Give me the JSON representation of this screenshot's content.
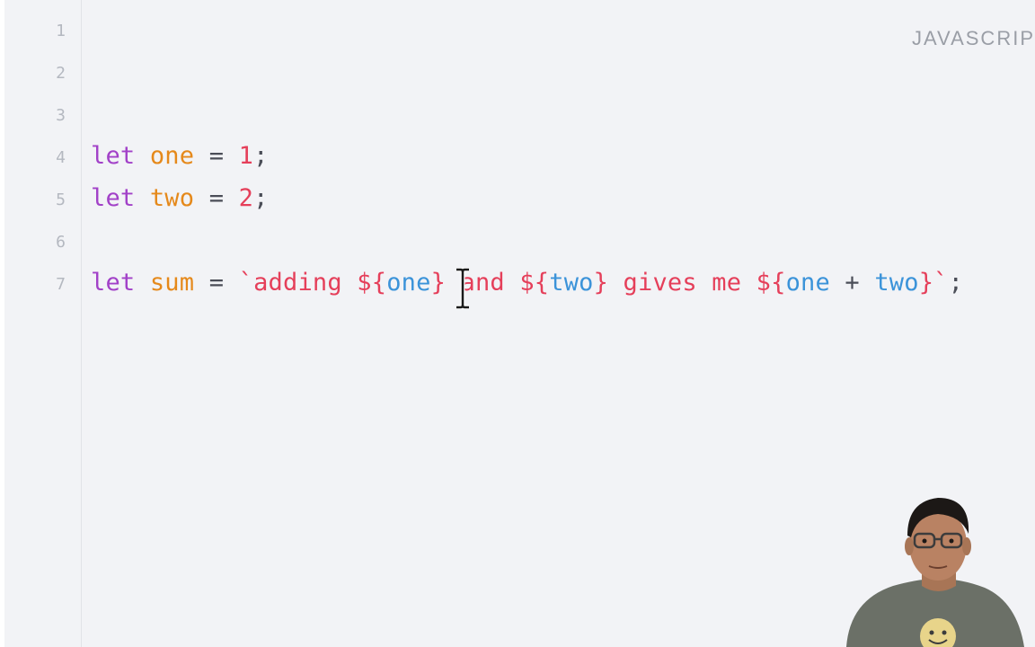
{
  "editor": {
    "language_label": "JAVASCRIP",
    "line_numbers": [
      "1",
      "2",
      "3",
      "4",
      "5",
      "6",
      "7"
    ],
    "lines": {
      "line4": {
        "kw": "let",
        "var": "one",
        "op": "=",
        "num": "1",
        "end": ";"
      },
      "line5": {
        "kw": "let",
        "var": "two",
        "op": "=",
        "num": "2",
        "end": ";"
      },
      "line7": {
        "kw": "let",
        "var": "sum",
        "op": "=",
        "str_open": "`adding ",
        "i1_open": "${",
        "i1_ident": "one",
        "i1_close": "}",
        "str_mid1": " and ",
        "i2_open": "${",
        "i2_ident": "two",
        "i2_close": "}",
        "str_mid2": " gives me ",
        "i3_open": "${",
        "i3_ident_a": "one",
        "i3_plus": " + ",
        "i3_ident_b": "two",
        "i3_close": "}",
        "str_close": "`",
        "end": ";"
      }
    }
  },
  "icons": {
    "cursor": "text-cursor-icon",
    "webcam": "presenter-webcam-overlay"
  },
  "colors": {
    "background": "#f2f3f6",
    "keyword": "#a241c8",
    "variable": "#e5891b",
    "number": "#e53f5a",
    "string": "#e53f5a",
    "identifier": "#3b93d9",
    "gutter_text": "#b4b8c0"
  }
}
